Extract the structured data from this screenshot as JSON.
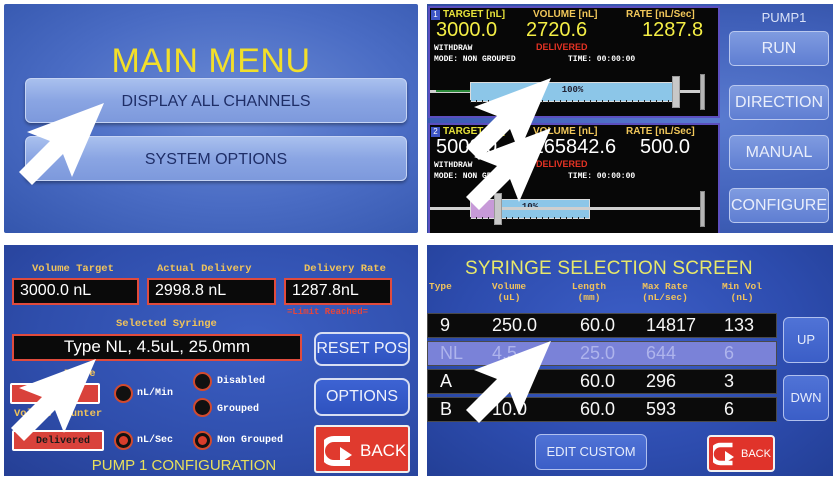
{
  "main_menu": {
    "title": "MAIN MENU",
    "buttons": [
      "DISPLAY ALL CHANNELS",
      "SYSTEM OPTIONS"
    ]
  },
  "pump": {
    "name": "PUMP1",
    "side_buttons": [
      "RUN",
      "DIRECTION",
      "MANUAL",
      "CONFIGURE"
    ],
    "channels": [
      {
        "number": "1",
        "target_label": "TARGET [nL]",
        "volume_label": "VOLUME [nL]",
        "rate_label": "RATE [nL/Sec]",
        "target": "3000.0",
        "volume": "2720.6",
        "rate": "1287.8",
        "direction": "WITHDRAW",
        "status": "DELIVERED",
        "mode": "MODE: NON GROUPED",
        "time": "TIME: 00:00:00",
        "progress_label": "100%",
        "progress": 1.0
      },
      {
        "number": "2",
        "target_label": "TARGET [nL]",
        "volume_label": "VOLUME [nL]",
        "rate_label": "RATE [nL/Sec]",
        "target": "5000.0",
        "volume": "-265842.6",
        "rate": "500.0",
        "direction": "WITHDRAW",
        "status": "DELIVERED",
        "mode": "MODE: NON GROUPED",
        "time": "TIME: 00:00:00",
        "progress_label": "10%",
        "progress": 0.1
      }
    ]
  },
  "config": {
    "labels": {
      "volume_target": "Volume Target",
      "actual_delivery": "Actual Delivery",
      "delivery_rate": "Delivery Rate",
      "selected_syringe": "Selected Syringe",
      "drive": "Drive",
      "volume_counter": "Volume Counter",
      "limit": "=Limit Reached="
    },
    "volume_target": "3000.0 nL",
    "actual_delivery": "2998.8 nL",
    "delivery_rate": "1287.8nL",
    "syringe": "Type NL, 4.5uL, 25.0mm",
    "options": {
      "lead": "Lead",
      "nl_min": "nL/Min",
      "disabled": "Disabled",
      "grouped": "Grouped",
      "delivered": "Delivered",
      "nl_sec": "nL/Sec",
      "non_grouped": "Non Grouped"
    },
    "buttons": {
      "reset": "RESET POS",
      "options": "OPTIONS",
      "back": "BACK"
    },
    "footer": "PUMP 1 CONFIGURATION"
  },
  "syringe_screen": {
    "title": "SYRINGE SELECTION SCREEN",
    "headers": [
      {
        "l1": "Type",
        "l2": ""
      },
      {
        "l1": "Volume",
        "l2": "(uL)"
      },
      {
        "l1": "Length",
        "l2": "(mm)"
      },
      {
        "l1": "Max Rate",
        "l2": "(nL/sec)"
      },
      {
        "l1": "Min Vol",
        "l2": "(nL)"
      }
    ],
    "rows": [
      [
        "9",
        "250.0",
        "60.0",
        "14817",
        "133"
      ],
      [
        "NL",
        "4.5",
        "25.0",
        "644",
        "6"
      ],
      [
        "A",
        "0",
        "60.0",
        "296",
        "3"
      ],
      [
        "B",
        "10.0",
        "60.0",
        "593",
        "6"
      ]
    ],
    "selected_row": 1,
    "buttons": {
      "up": "UP",
      "down": "DWN",
      "edit": "EDIT CUSTOM",
      "back": "BACK"
    }
  },
  "colors": {
    "menu_title": "#f2df2a",
    "alert_red": "#e03a2e",
    "label_gold": "#f0c35a",
    "value_yellow": "#f4ee45"
  }
}
